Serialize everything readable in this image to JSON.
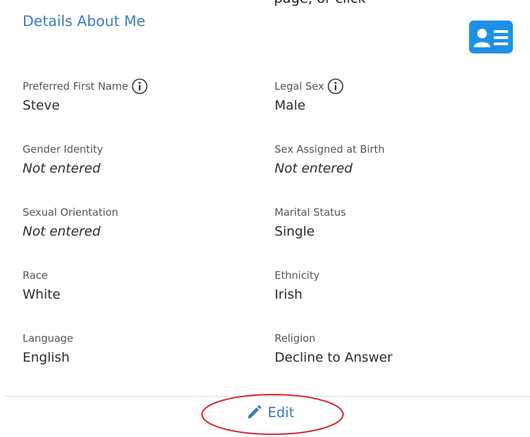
{
  "top_clip_text": "page, or click",
  "card": {
    "title": "Details About Me",
    "icon": "id-card-icon",
    "accent_color": "#3b7bbf",
    "icon_color": "#1e90e8"
  },
  "fields": {
    "preferred_first_name": {
      "label": "Preferred First Name",
      "value": "Steve"
    },
    "legal_sex": {
      "label": "Legal Sex",
      "value": "Male"
    },
    "gender_identity": {
      "label": "Gender Identity",
      "value": "Not entered"
    },
    "sex_assigned_at_birth": {
      "label": "Sex Assigned at Birth",
      "value": "Not entered"
    },
    "sexual_orientation": {
      "label": "Sexual Orientation",
      "value": "Not entered"
    },
    "marital_status": {
      "label": "Marital Status",
      "value": "Single"
    },
    "race": {
      "label": "Race",
      "value": "White"
    },
    "ethnicity": {
      "label": "Ethnicity",
      "value": "Irish"
    },
    "language": {
      "label": "Language",
      "value": "English"
    },
    "religion": {
      "label": "Religion",
      "value": "Decline to Answer"
    }
  },
  "edit": {
    "label": "Edit",
    "icon": "pencil-icon",
    "highlight_color": "#d9262b"
  }
}
